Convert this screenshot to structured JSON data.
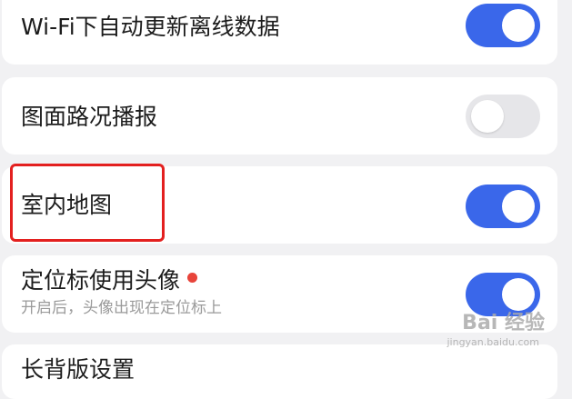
{
  "settings": [
    {
      "label": "Wi-Fi下自动更新离线数据",
      "enabled": true
    },
    {
      "label": "图面路况播报",
      "enabled": false
    },
    {
      "label": "室内地图",
      "enabled": true
    },
    {
      "label": "定位标使用头像",
      "sublabel": "开启后，头像出现在定位标上",
      "enabled": true,
      "has_new_badge": true
    },
    {
      "label": "长背版设置"
    }
  ],
  "colors": {
    "toggle_on": "#3a67ea",
    "toggle_off": "#e6e6e9",
    "badge": "#e8443a",
    "highlight": "#e3201f"
  },
  "watermark": {
    "main": "Bai 经验",
    "sub": "jingyan.baidu.com"
  }
}
